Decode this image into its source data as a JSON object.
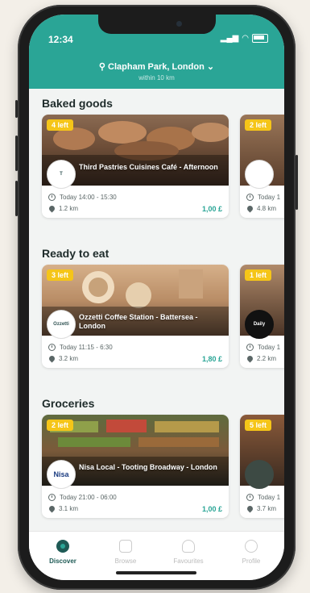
{
  "status": {
    "time": "12:34"
  },
  "header": {
    "location": "Clapham Park, London",
    "radius": "within 10 km"
  },
  "colors": {
    "brand": "#2aa596",
    "badge": "#f5c518"
  },
  "sections": [
    {
      "title": "Baked goods",
      "card": {
        "badge": "4 left",
        "name": "Third Pastries Cuisines Café - Afternoon",
        "logo": "T",
        "time": "Today 14:00 - 15:30",
        "distance": "1.2 km",
        "price": "1,00 £"
      },
      "peek": {
        "badge": "2 left",
        "time": "Today 1",
        "distance": "4.8 km"
      }
    },
    {
      "title": "Ready to eat",
      "card": {
        "badge": "3 left",
        "name": "Ozzetti Coffee Station - Battersea - London",
        "logo": "Ozzetti",
        "time": "Today 11:15 - 6:30",
        "distance": "3.2 km",
        "price": "1,80 £"
      },
      "peek": {
        "badge": "1 left",
        "time": "Today 1",
        "distance": "2.2 km",
        "logo": "Daily"
      }
    },
    {
      "title": "Groceries",
      "card": {
        "badge": "2 left",
        "name": "Nisa Local - Tooting Broadway - London",
        "logo": "Nisa",
        "time": "Today 21:00 - 06:00",
        "distance": "3.1 km",
        "price": "1,00 £"
      },
      "peek": {
        "badge": "5 left",
        "time": "Today 1",
        "distance": "3.7 km"
      }
    }
  ],
  "tabs": [
    {
      "label": "Discover",
      "icon": "discover-icon"
    },
    {
      "label": "Browse",
      "icon": "bag-icon"
    },
    {
      "label": "Favourites",
      "icon": "heart-icon"
    },
    {
      "label": "Profile",
      "icon": "profile-icon"
    }
  ]
}
